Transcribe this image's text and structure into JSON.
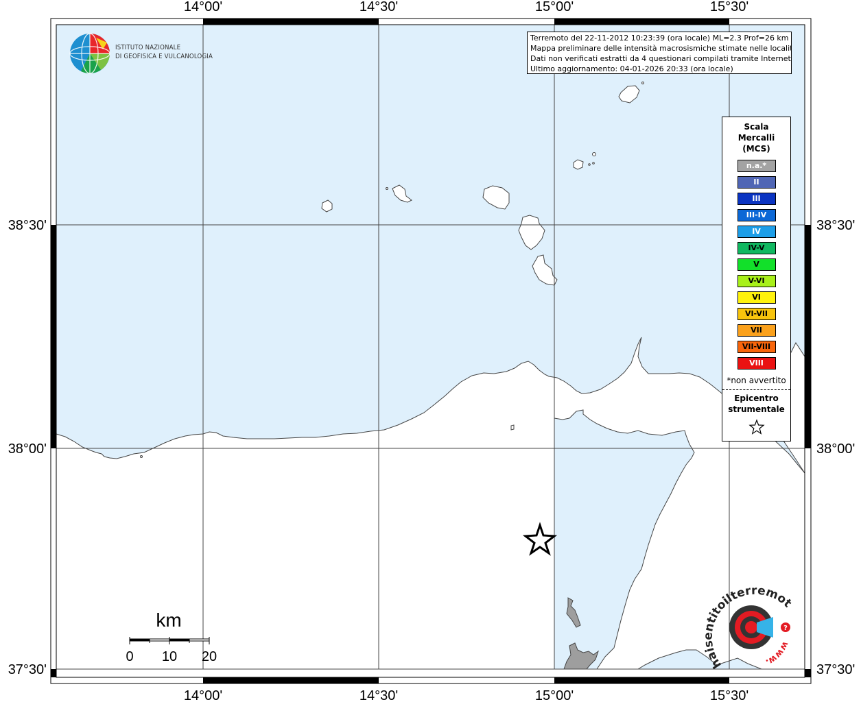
{
  "header": {
    "lines": [
      "Terremoto del 22-11-2012 10:23:39 (ora locale) ML=2.3 Prof=26 km",
      "Mappa preliminare delle intensità macrosismiche stimate nelle località",
      "Dati non verificati estratti da 4 questionari compilati tramite Internet.",
      "Ultimo aggiornamento: 04-01-2026 20:33 (ora locale)"
    ]
  },
  "logo": {
    "line1": "ISTITUTO NAZIONALE",
    "line2": "DI GEOFISICA E VULCANOLOGIA"
  },
  "grid": {
    "lon_labels": [
      "14°00'",
      "14°30'",
      "15°00'",
      "15°30'"
    ],
    "lat_labels": [
      "38°30'",
      "38°00'",
      "37°30'"
    ]
  },
  "legend": {
    "title": "Scala Mercalli (MCS)",
    "items": [
      {
        "label": "n.a.*",
        "color": "#a3a3a3",
        "text_color": "#ffffff"
      },
      {
        "label": "II",
        "color": "#5066b5",
        "text_color": "#ffffff"
      },
      {
        "label": "III",
        "color": "#0a34c2",
        "text_color": "#ffffff"
      },
      {
        "label": "III-IV",
        "color": "#0c68d6",
        "text_color": "#ffffff"
      },
      {
        "label": "IV",
        "color": "#1d9ee8",
        "text_color": "#ffffff"
      },
      {
        "label": "IV-V",
        "color": "#10b860",
        "text_color": "#000000"
      },
      {
        "label": "V",
        "color": "#12e02a",
        "text_color": "#000000"
      },
      {
        "label": "V-VI",
        "color": "#a8f01a",
        "text_color": "#000000"
      },
      {
        "label": "VI",
        "color": "#fff20c",
        "text_color": "#000000"
      },
      {
        "label": "VI-VII",
        "color": "#f8c40c",
        "text_color": "#000000"
      },
      {
        "label": "VII",
        "color": "#fba11c",
        "text_color": "#000000"
      },
      {
        "label": "VII-VIII",
        "color": "#f8650b",
        "text_color": "#000000"
      },
      {
        "label": "VIII",
        "color": "#ea1212",
        "text_color": "#ffffff"
      }
    ],
    "note": "*non avvertito",
    "epicenter_label": "Epicentro strumentale",
    "epicenter_symbol": "star-icon"
  },
  "scale_bar": {
    "unit": "km",
    "ticks": [
      "0",
      "10",
      "20"
    ]
  },
  "badge": {
    "text": "haisentitoilterremoto.it",
    "www": "www.",
    "question": "?"
  },
  "colors": {
    "sea": "#dff0fc",
    "land": "#ffffff",
    "etna": "#9e9e9e"
  }
}
